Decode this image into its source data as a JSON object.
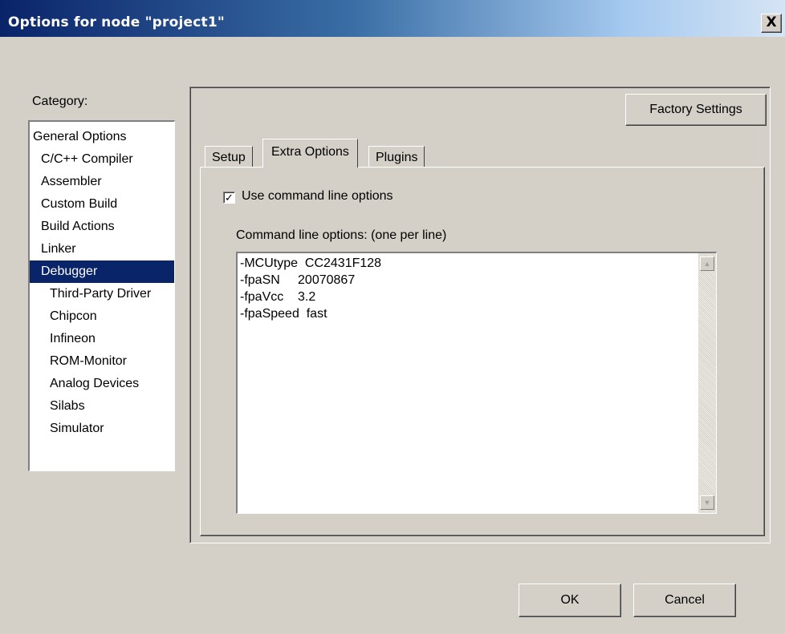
{
  "window": {
    "title": "Options for node \"project1\"",
    "close_glyph": "X"
  },
  "category": {
    "label": "Category:",
    "items": [
      {
        "label": "General Options",
        "level": 0
      },
      {
        "label": "C/C++ Compiler",
        "level": 1
      },
      {
        "label": "Assembler",
        "level": 1
      },
      {
        "label": "Custom Build",
        "level": 1
      },
      {
        "label": "Build Actions",
        "level": 1
      },
      {
        "label": "Linker",
        "level": 1
      },
      {
        "label": "Debugger",
        "level": 1,
        "selected": true
      },
      {
        "label": "Third-Party Driver",
        "level": 2
      },
      {
        "label": "Chipcon",
        "level": 2
      },
      {
        "label": "Infineon",
        "level": 2
      },
      {
        "label": "ROM-Monitor",
        "level": 2
      },
      {
        "label": "Analog Devices",
        "level": 2
      },
      {
        "label": "Silabs",
        "level": 2
      },
      {
        "label": "Simulator",
        "level": 2
      }
    ]
  },
  "panel": {
    "factory_settings_label": "Factory Settings",
    "tabs": [
      {
        "label": "Setup"
      },
      {
        "label": "Extra Options",
        "active": true
      },
      {
        "label": "Plugins"
      }
    ],
    "use_cmd_checkbox": {
      "label": "Use command line options",
      "checked": true,
      "check_glyph": "✓"
    },
    "cmd_label": "Command line options:  (one per line)",
    "cmd_lines": [
      "-MCUtype  CC2431F128",
      "-fpaSN     20070867",
      "-fpaVcc    3.2",
      "-fpaSpeed  fast"
    ],
    "scroll_up_glyph": "▲",
    "scroll_down_glyph": "▼"
  },
  "footer": {
    "ok_label": "OK",
    "cancel_label": "Cancel"
  },
  "colors": {
    "dialog_bg": "#d4d0c8",
    "titlebar_start": "#0a246a",
    "titlebar_end": "#d6e4f4",
    "selection_bg": "#0a246a"
  }
}
